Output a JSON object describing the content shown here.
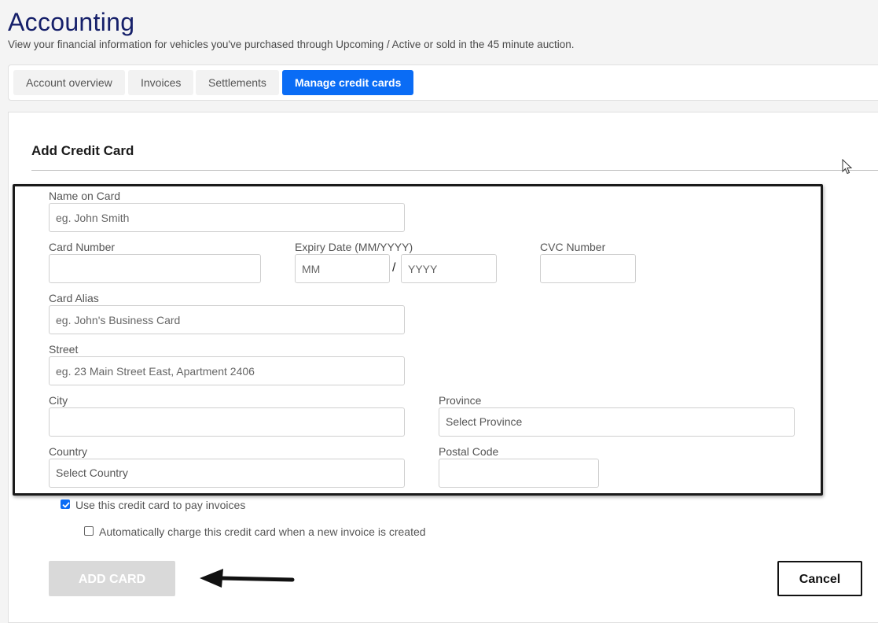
{
  "page": {
    "title": "Accounting",
    "subtitle": "View your financial information for vehicles you've purchased through Upcoming / Active or sold in the 45 minute auction."
  },
  "tabs": [
    {
      "label": "Account overview",
      "active": false
    },
    {
      "label": "Invoices",
      "active": false
    },
    {
      "label": "Settlements",
      "active": false
    },
    {
      "label": "Manage credit cards",
      "active": true
    }
  ],
  "form": {
    "title": "Add Credit Card",
    "name_on_card": {
      "label": "Name on Card",
      "placeholder": "eg. John Smith",
      "value": ""
    },
    "card_number": {
      "label": "Card Number",
      "placeholder": "",
      "value": ""
    },
    "expiry": {
      "label": "Expiry Date (MM/YYYY)",
      "month_placeholder": "MM",
      "year_placeholder": "YYYY",
      "separator": "/"
    },
    "cvc": {
      "label": "CVC Number",
      "placeholder": "",
      "value": ""
    },
    "card_alias": {
      "label": "Card Alias",
      "placeholder": "eg. John's Business Card",
      "value": ""
    },
    "street": {
      "label": "Street",
      "placeholder": "eg. 23 Main Street East, Apartment 2406",
      "value": ""
    },
    "city": {
      "label": "City",
      "placeholder": "",
      "value": ""
    },
    "province": {
      "label": "Province",
      "selected": "Select Province"
    },
    "country": {
      "label": "Country",
      "selected": "Select Country"
    },
    "postal_code": {
      "label": "Postal Code",
      "placeholder": "",
      "value": ""
    },
    "use_for_invoices": {
      "label": "Use this credit card to pay invoices",
      "checked": true
    },
    "auto_charge": {
      "label": "Automatically charge this credit card when a new invoice is created",
      "checked": false
    }
  },
  "actions": {
    "add_card_label": "ADD CARD",
    "cancel_label": "Cancel"
  },
  "colors": {
    "title": "#16206a",
    "accent": "#0a6cf5",
    "disabled_button": "#d9d9d9"
  },
  "icons": {
    "annotation_arrow": "left-arrow-icon",
    "mouse_cursor": "mouse-cursor-icon",
    "checkmark": "checkmark-icon"
  }
}
